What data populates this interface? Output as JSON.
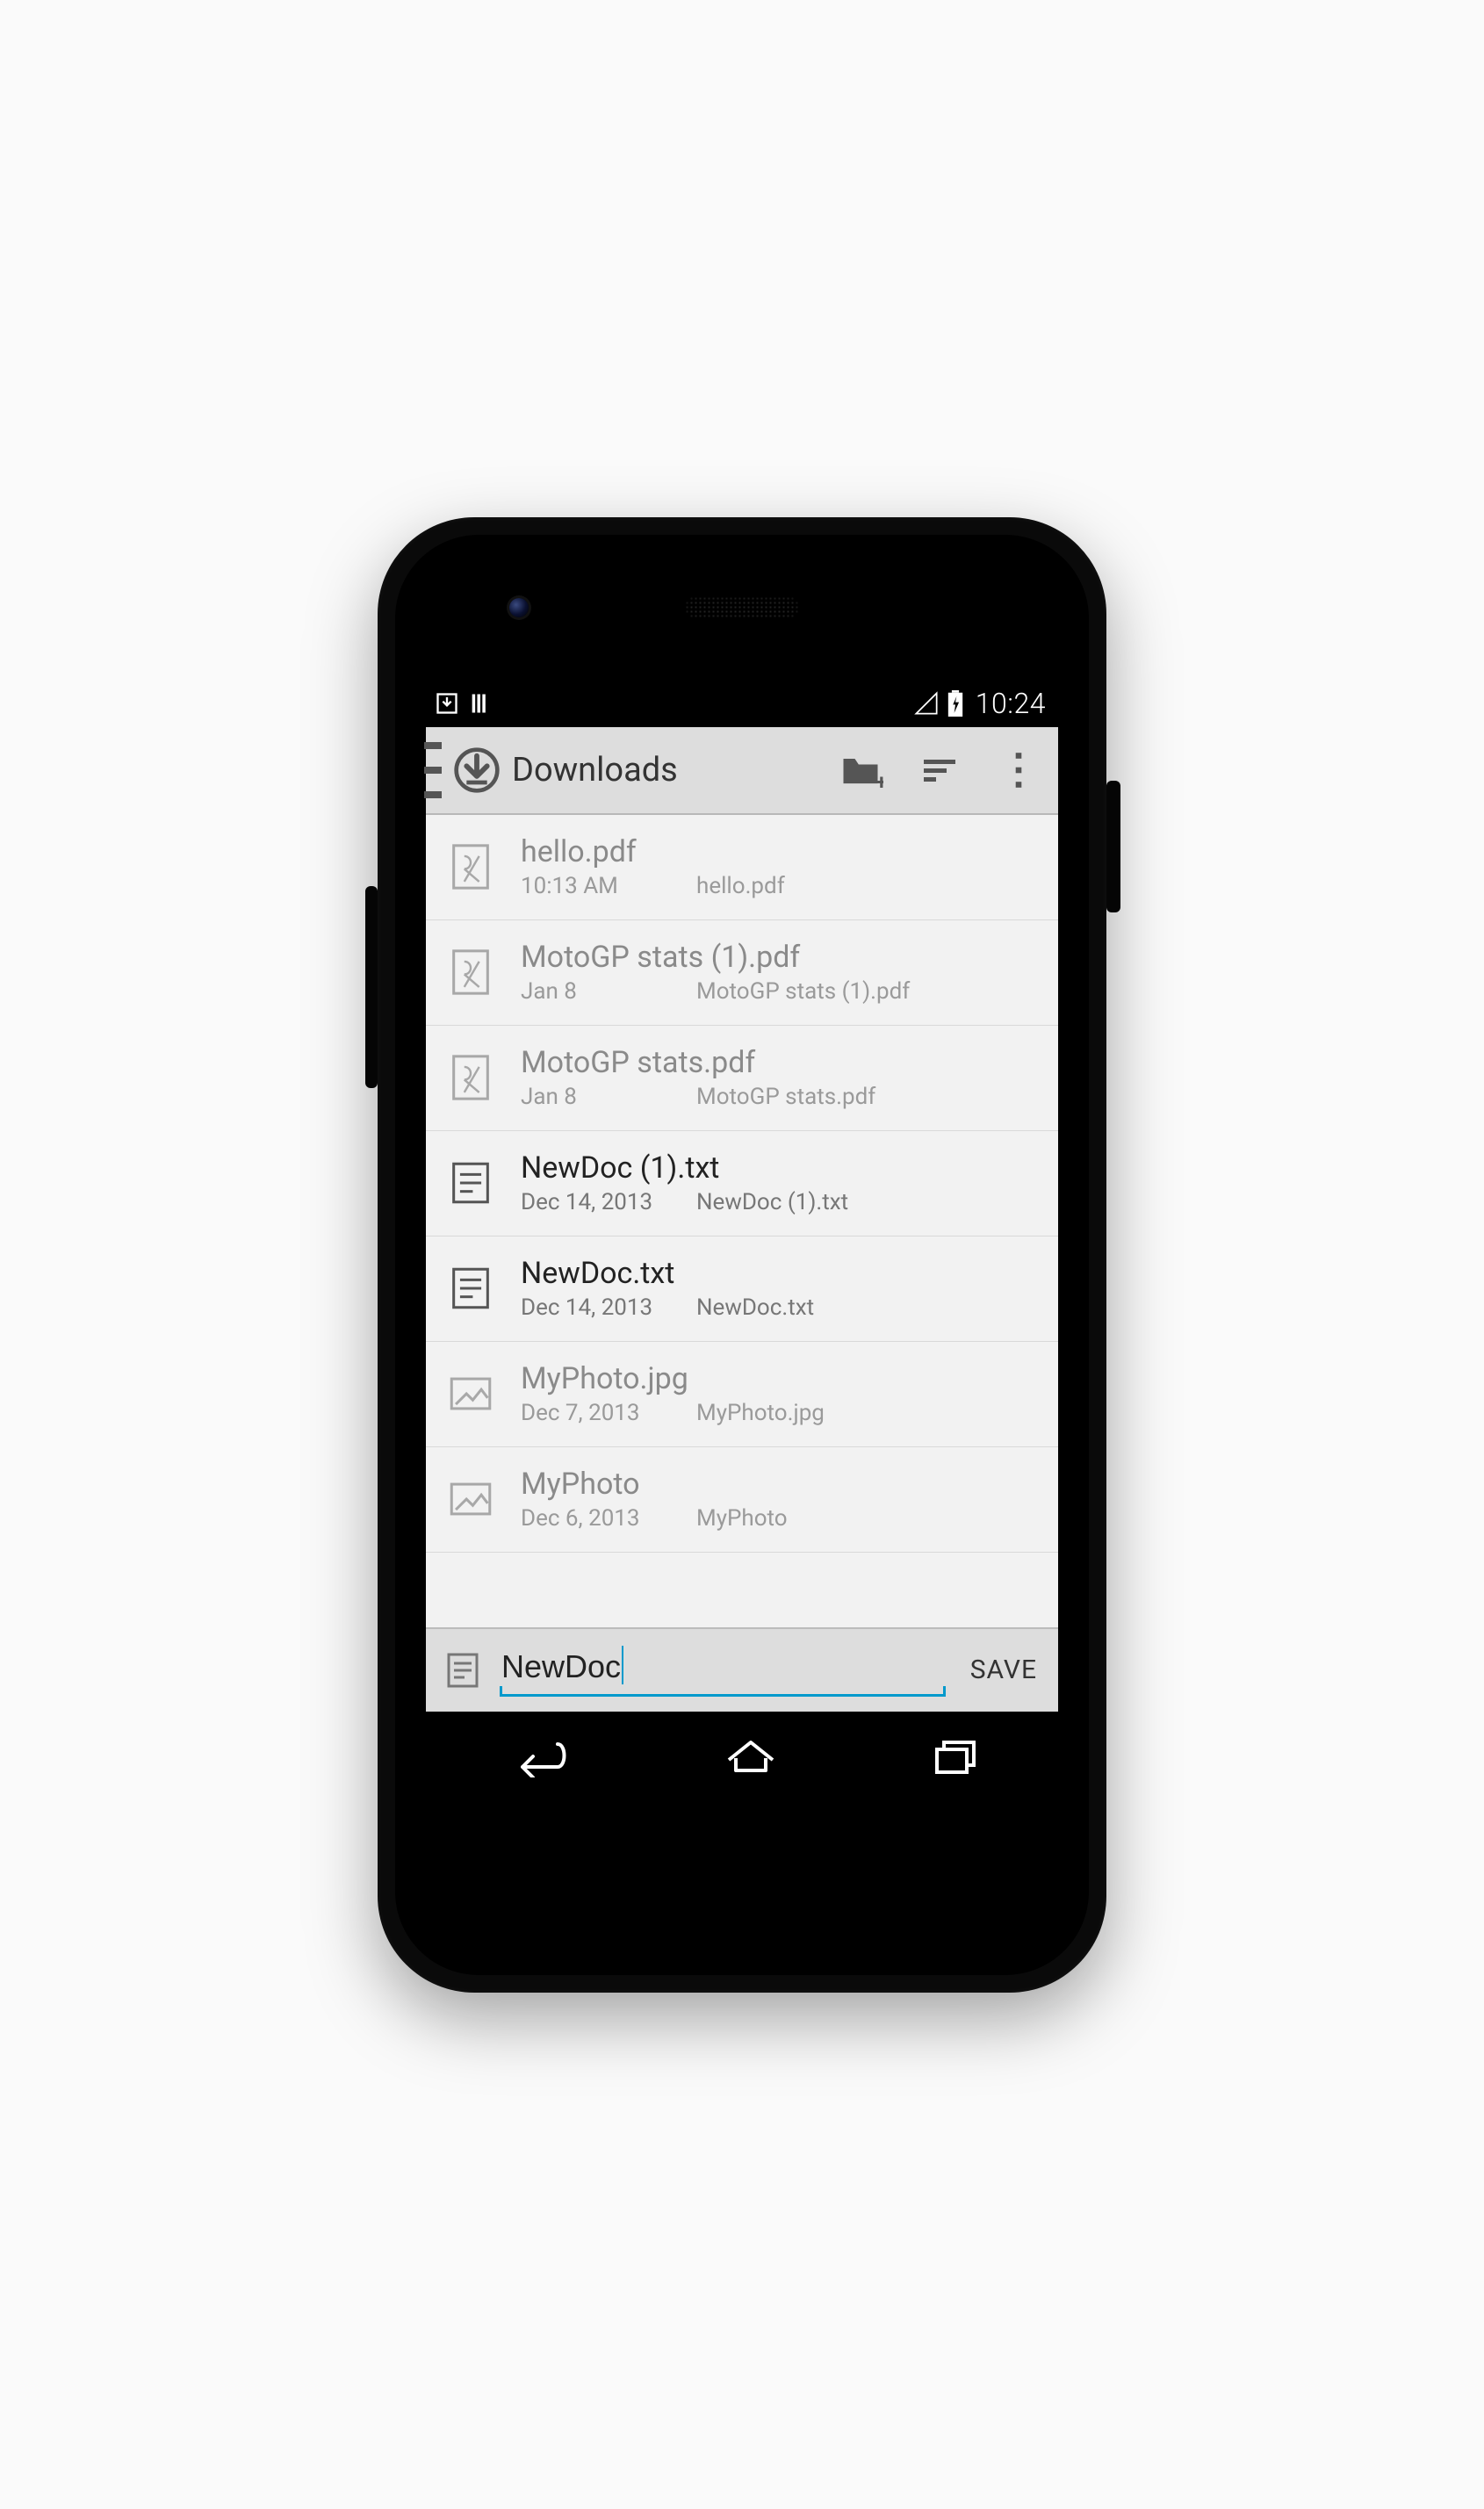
{
  "statusbar": {
    "time": "10:24"
  },
  "actionbar": {
    "title": "Downloads"
  },
  "files": [
    {
      "name": "hello.pdf",
      "date": "10:13 AM",
      "filename": "hello.pdf",
      "type": "pdf",
      "dim": true
    },
    {
      "name": "MotoGP stats (1).pdf",
      "date": "Jan 8",
      "filename": "MotoGP stats (1).pdf",
      "type": "pdf",
      "dim": true
    },
    {
      "name": "MotoGP stats.pdf",
      "date": "Jan 8",
      "filename": "MotoGP stats.pdf",
      "type": "pdf",
      "dim": true
    },
    {
      "name": "NewDoc (1).txt",
      "date": "Dec 14, 2013",
      "filename": "NewDoc (1).txt",
      "type": "txt",
      "dim": false
    },
    {
      "name": "NewDoc.txt",
      "date": "Dec 14, 2013",
      "filename": "NewDoc.txt",
      "type": "txt",
      "dim": false
    },
    {
      "name": "MyPhoto.jpg",
      "date": "Dec 7, 2013",
      "filename": "MyPhoto.jpg",
      "type": "image",
      "dim": true
    },
    {
      "name": "MyPhoto",
      "date": "Dec 6, 2013",
      "filename": "MyPhoto",
      "type": "image",
      "dim": true
    }
  ],
  "savebar": {
    "input_value": "NewDoc",
    "save_label": "SAVE"
  }
}
